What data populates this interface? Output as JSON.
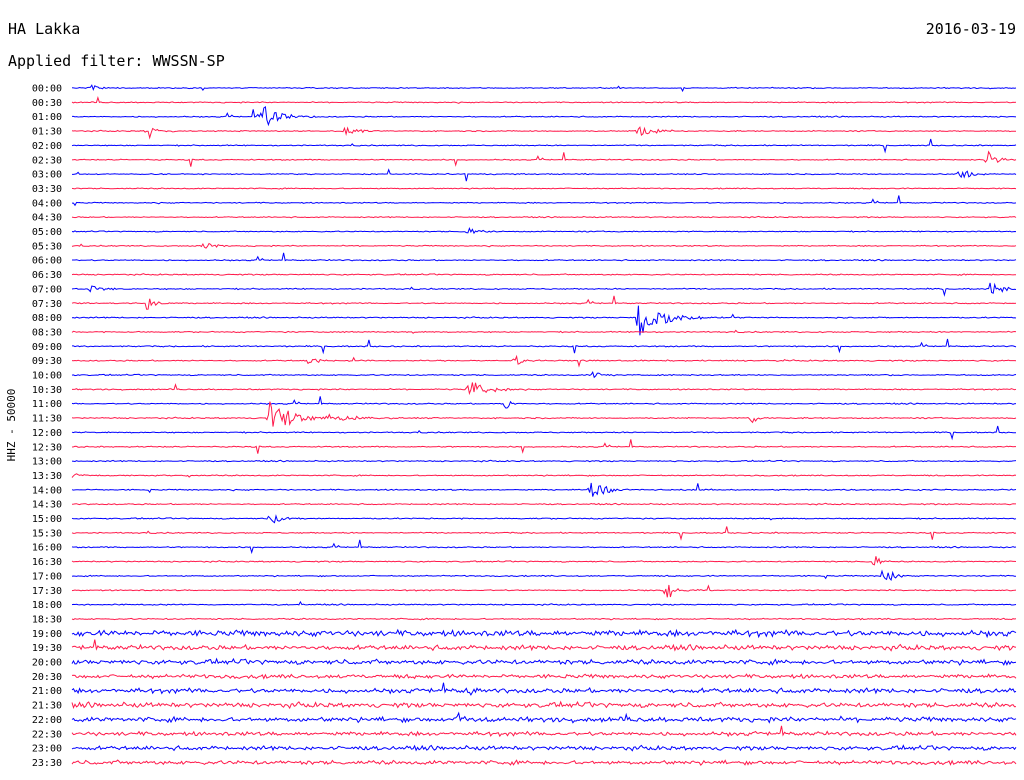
{
  "header": {
    "station": "HA Lakka",
    "date": "2016-03-19",
    "filter": "Applied filter: WWSSN-SP"
  },
  "chart_data": {
    "type": "line",
    "title": "",
    "ylabel": "HHZ - 50000",
    "xlabel": "",
    "grid": false,
    "row_labels": [
      "00:00",
      "00:30",
      "01:00",
      "01:30",
      "02:00",
      "02:30",
      "03:00",
      "03:30",
      "04:00",
      "04:30",
      "05:00",
      "05:30",
      "06:00",
      "06:30",
      "07:00",
      "07:30",
      "08:00",
      "08:30",
      "09:00",
      "09:30",
      "10:00",
      "10:30",
      "11:00",
      "11:30",
      "12:00",
      "12:30",
      "13:00",
      "13:30",
      "14:00",
      "14:30",
      "15:00",
      "15:30",
      "16:00",
      "16:30",
      "17:00",
      "17:30",
      "18:00",
      "18:30",
      "19:00",
      "19:30",
      "20:00",
      "20:30",
      "21:00",
      "21:30",
      "22:00",
      "22:30",
      "23:00",
      "23:30"
    ],
    "colors": [
      "#0000ff",
      "#ff1a4b"
    ],
    "noise_levels": [
      0.08,
      0.08,
      0.08,
      0.08,
      0.08,
      0.08,
      0.08,
      0.08,
      0.08,
      0.08,
      0.08,
      0.08,
      0.09,
      0.09,
      0.09,
      0.09,
      0.09,
      0.09,
      0.09,
      0.09,
      0.09,
      0.09,
      0.09,
      0.09,
      0.09,
      0.09,
      0.09,
      0.09,
      0.09,
      0.09,
      0.09,
      0.09,
      0.09,
      0.09,
      0.09,
      0.09,
      0.09,
      0.1,
      0.45,
      0.35,
      0.35,
      0.3,
      0.35,
      0.35,
      0.35,
      0.3,
      0.3,
      0.3
    ],
    "events": [
      {
        "row": 0,
        "t": 0.02,
        "amp": 0.5,
        "dur": 0.03
      },
      {
        "row": 2,
        "t": 0.2,
        "amp": 2.2,
        "dur": 0.06
      },
      {
        "row": 3,
        "t": 0.08,
        "amp": 0.7,
        "dur": 0.03
      },
      {
        "row": 3,
        "t": 0.29,
        "amp": 0.9,
        "dur": 0.03
      },
      {
        "row": 3,
        "t": 0.6,
        "amp": 0.8,
        "dur": 0.06
      },
      {
        "row": 5,
        "t": 0.97,
        "amp": 1.5,
        "dur": 0.03
      },
      {
        "row": 6,
        "t": 0.94,
        "amp": 1.3,
        "dur": 0.03
      },
      {
        "row": 10,
        "t": 0.42,
        "amp": 0.6,
        "dur": 0.04
      },
      {
        "row": 11,
        "t": 0.14,
        "amp": 0.6,
        "dur": 0.05
      },
      {
        "row": 14,
        "t": 0.02,
        "amp": 0.7,
        "dur": 0.04
      },
      {
        "row": 14,
        "t": 0.975,
        "amp": 1.2,
        "dur": 0.03
      },
      {
        "row": 15,
        "t": 0.08,
        "amp": 1.4,
        "dur": 0.02
      },
      {
        "row": 16,
        "t": 0.6,
        "amp": 3.2,
        "dur": 0.07
      },
      {
        "row": 19,
        "t": 0.25,
        "amp": 0.6,
        "dur": 0.04
      },
      {
        "row": 19,
        "t": 0.47,
        "amp": 1.1,
        "dur": 0.02
      },
      {
        "row": 20,
        "t": 0.55,
        "amp": 0.7,
        "dur": 0.03
      },
      {
        "row": 21,
        "t": 0.42,
        "amp": 1.7,
        "dur": 0.05
      },
      {
        "row": 22,
        "t": 0.46,
        "amp": 0.9,
        "dur": 0.02
      },
      {
        "row": 23,
        "t": 0.21,
        "amp": 3.4,
        "dur": 0.06
      },
      {
        "row": 23,
        "t": 0.27,
        "amp": 0.8,
        "dur": 0.08
      },
      {
        "row": 23,
        "t": 0.72,
        "amp": 1.0,
        "dur": 0.02
      },
      {
        "row": 27,
        "t": 0.0,
        "amp": 0.6,
        "dur": 0.03
      },
      {
        "row": 28,
        "t": 0.55,
        "amp": 1.9,
        "dur": 0.04
      },
      {
        "row": 30,
        "t": 0.21,
        "amp": 1.0,
        "dur": 0.04
      },
      {
        "row": 33,
        "t": 0.85,
        "amp": 1.2,
        "dur": 0.02
      },
      {
        "row": 34,
        "t": 0.86,
        "amp": 1.6,
        "dur": 0.03
      },
      {
        "row": 35,
        "t": 0.63,
        "amp": 1.6,
        "dur": 0.03
      },
      {
        "row": 42,
        "t": 0.42,
        "amp": 1.4,
        "dur": 0.02
      },
      {
        "row": 44,
        "t": 0.41,
        "amp": 1.3,
        "dur": 0.03
      }
    ]
  }
}
